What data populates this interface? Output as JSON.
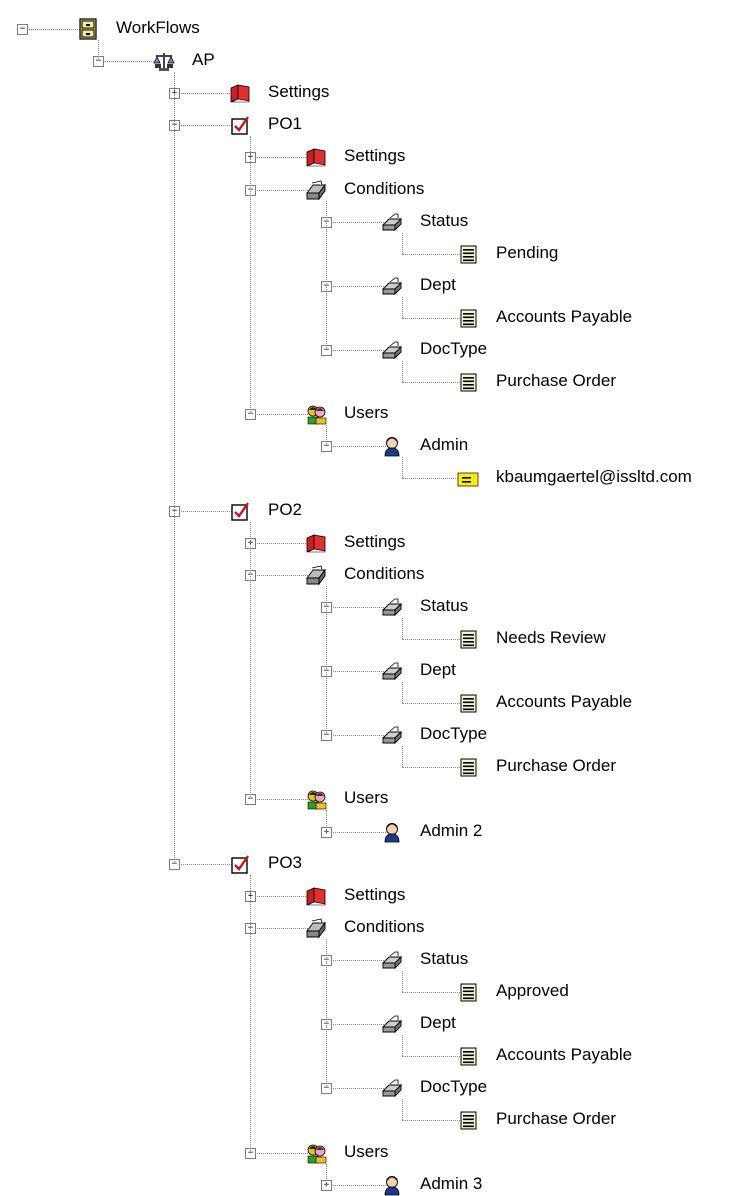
{
  "tree": [
    {
      "label": "WorkFlows",
      "icon": "cabinet-icon",
      "depth": 0,
      "toggle": "-",
      "children": [
        {
          "label": "AP",
          "icon": "scales-icon",
          "toggle": "-",
          "children": [
            {
              "label": "Settings",
              "icon": "settings-book-icon",
              "toggle": "+"
            },
            {
              "label": "PO1",
              "icon": "checkbox-icon",
              "toggle": "-",
              "children": [
                {
                  "label": "Settings",
                  "icon": "settings-book-icon",
                  "toggle": "+"
                },
                {
                  "label": "Conditions",
                  "icon": "conditions-icon",
                  "toggle": "-",
                  "children": [
                    {
                      "label": "Status",
                      "icon": "condition-field-icon",
                      "toggle": "-",
                      "children": [
                        {
                          "label": "Pending",
                          "icon": "value-lines-icon"
                        }
                      ]
                    },
                    {
                      "label": "Dept",
                      "icon": "condition-field-icon",
                      "toggle": "-",
                      "children": [
                        {
                          "label": "Accounts Payable",
                          "icon": "value-lines-icon"
                        }
                      ]
                    },
                    {
                      "label": "DocType",
                      "icon": "condition-field-icon",
                      "toggle": "-",
                      "children": [
                        {
                          "label": "Purchase Order",
                          "icon": "value-lines-icon"
                        }
                      ]
                    }
                  ]
                },
                {
                  "label": "Users",
                  "icon": "users-icon",
                  "toggle": "-",
                  "children": [
                    {
                      "label": "Admin",
                      "icon": "user-icon",
                      "toggle": "-",
                      "children": [
                        {
                          "label": "kbaumgaertel@issltd.com",
                          "icon": "email-icon"
                        }
                      ]
                    }
                  ]
                }
              ]
            },
            {
              "label": "PO2",
              "icon": "checkbox-icon",
              "toggle": "-",
              "children": [
                {
                  "label": "Settings",
                  "icon": "settings-book-icon",
                  "toggle": "+"
                },
                {
                  "label": "Conditions",
                  "icon": "conditions-icon",
                  "toggle": "-",
                  "children": [
                    {
                      "label": "Status",
                      "icon": "condition-field-icon",
                      "toggle": "-",
                      "children": [
                        {
                          "label": "Needs Review",
                          "icon": "value-lines-icon"
                        }
                      ]
                    },
                    {
                      "label": "Dept",
                      "icon": "condition-field-icon",
                      "toggle": "-",
                      "children": [
                        {
                          "label": "Accounts Payable",
                          "icon": "value-lines-icon"
                        }
                      ]
                    },
                    {
                      "label": "DocType",
                      "icon": "condition-field-icon",
                      "toggle": "-",
                      "children": [
                        {
                          "label": "Purchase Order",
                          "icon": "value-lines-icon"
                        }
                      ]
                    }
                  ]
                },
                {
                  "label": "Users",
                  "icon": "users-icon",
                  "toggle": "-",
                  "children": [
                    {
                      "label": "Admin 2",
                      "icon": "user-icon",
                      "toggle": "+"
                    }
                  ]
                }
              ]
            },
            {
              "label": "PO3",
              "icon": "checkbox-icon",
              "toggle": "-",
              "children": [
                {
                  "label": "Settings",
                  "icon": "settings-book-icon",
                  "toggle": "+"
                },
                {
                  "label": "Conditions",
                  "icon": "conditions-icon",
                  "toggle": "-",
                  "children": [
                    {
                      "label": "Status",
                      "icon": "condition-field-icon",
                      "toggle": "-",
                      "children": [
                        {
                          "label": "Approved",
                          "icon": "value-lines-icon"
                        }
                      ]
                    },
                    {
                      "label": "Dept",
                      "icon": "condition-field-icon",
                      "toggle": "-",
                      "children": [
                        {
                          "label": "Accounts Payable",
                          "icon": "value-lines-icon"
                        }
                      ]
                    },
                    {
                      "label": "DocType",
                      "icon": "condition-field-icon",
                      "toggle": "-",
                      "children": [
                        {
                          "label": "Purchase Order",
                          "icon": "value-lines-icon"
                        }
                      ]
                    }
                  ]
                },
                {
                  "label": "Users",
                  "icon": "users-icon",
                  "toggle": "-",
                  "children": [
                    {
                      "label": "Admin 3",
                      "icon": "user-icon",
                      "toggle": "+"
                    }
                  ]
                }
              ]
            }
          ]
        }
      ]
    }
  ]
}
